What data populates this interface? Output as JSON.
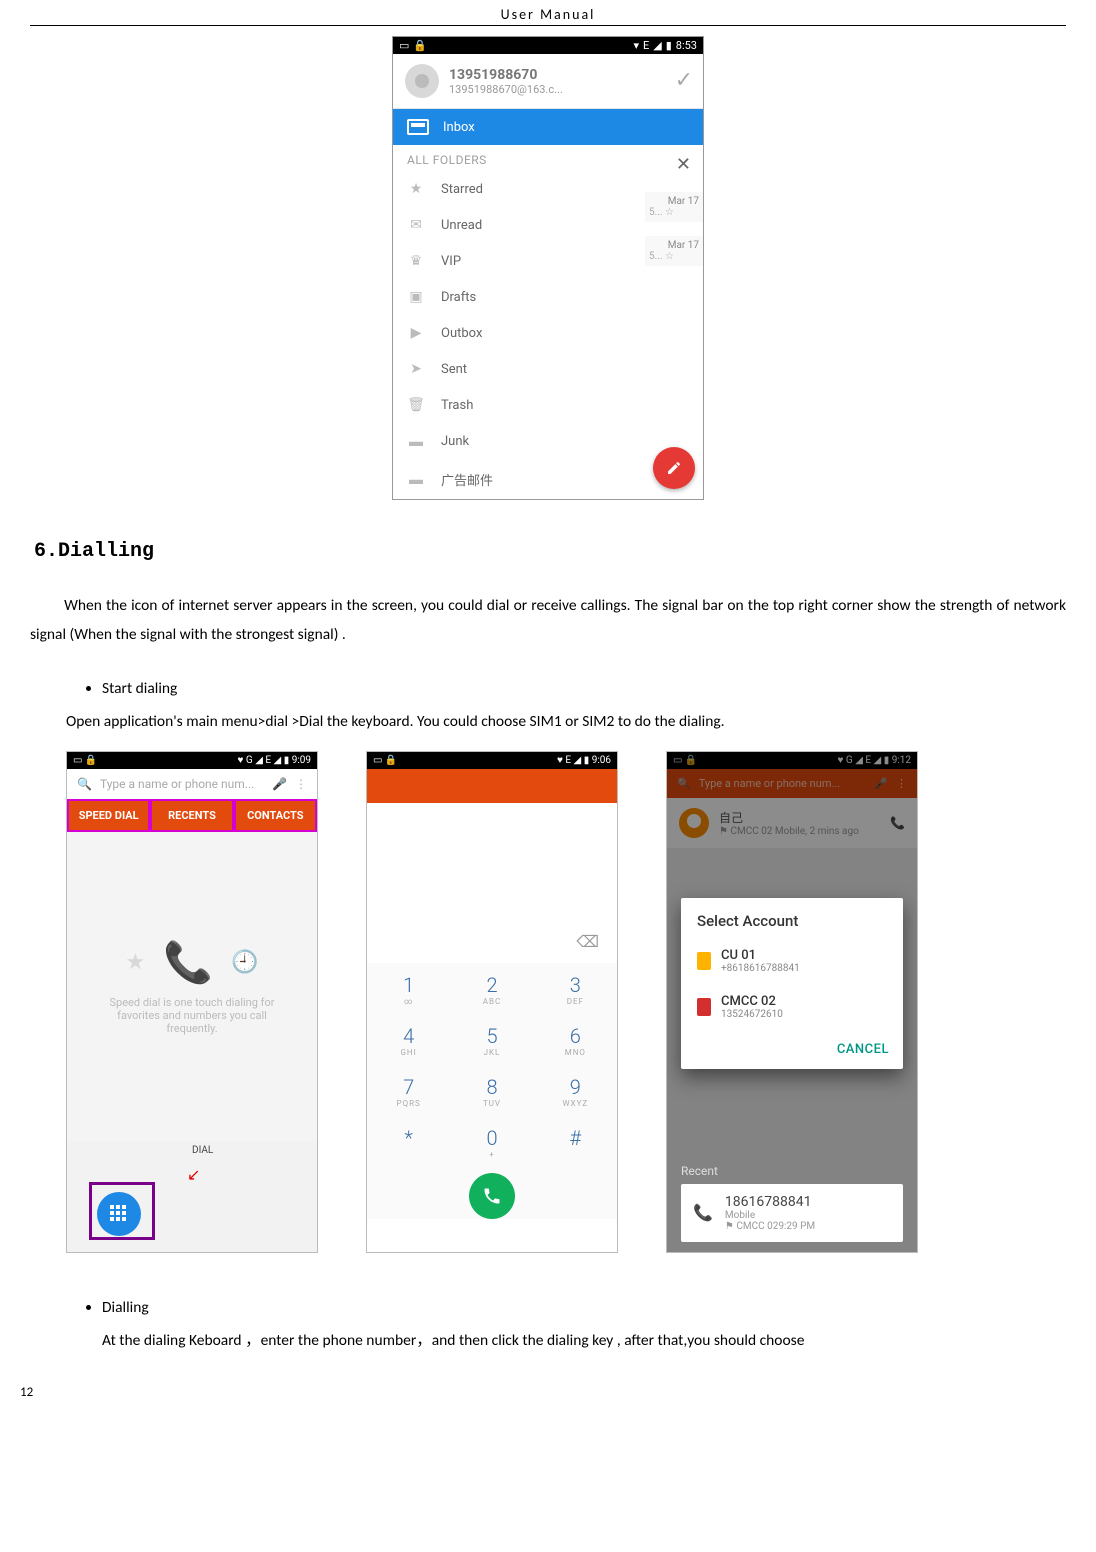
{
  "doc": {
    "header": "User    Manual",
    "page_number": "12"
  },
  "email_shot": {
    "status": {
      "time": "8:53",
      "net": "E",
      "wifi": "▾",
      "batt": "▮"
    },
    "account": {
      "number": "13951988670",
      "email": "13951988670@163.c..."
    },
    "inbox_label": "Inbox",
    "all_folders_label": "ALL FOLDERS",
    "folders": [
      {
        "icon": "★",
        "label": "Starred"
      },
      {
        "icon": "✉",
        "label": "Unread"
      },
      {
        "icon": "♛",
        "label": "VIP"
      },
      {
        "icon": "▣",
        "label": "Drafts"
      },
      {
        "icon": "▶",
        "label": "Outbox"
      },
      {
        "icon": "➤",
        "label": "Sent"
      },
      {
        "icon": "🗑",
        "label": "Trash"
      },
      {
        "icon": "▬",
        "label": "Junk"
      },
      {
        "icon": "▬",
        "label": "广告邮件"
      }
    ],
    "peek": {
      "date1": "Mar 17",
      "snip1": "5... ☆",
      "date2": "Mar 17",
      "snip2": "5... ☆"
    }
  },
  "section": {
    "heading": "6.Dialling",
    "para1": "When the icon of internet server appears in the screen, you could dial or receive callings. The signal bar on the top right corner show the strength of network signal (When the signal with the strongest signal) .",
    "bullet1": "Start dialing",
    "after_bullet1": "Open application's main menu>dial >Dial the keyboard. You could choose SIM1 or SIM2 to do the dialing.",
    "bullet2": "Dialling",
    "after_bullet2": "At the dialing Keboard  ，enter the phone number，and then click the dialing key , after that,you should choose"
  },
  "shot1": {
    "status_time": "9:09",
    "status_net": "G ◢ E ◢",
    "search_placeholder": "Type a name or phone num...",
    "tabs": [
      "SPEED DIAL",
      "RECENTS",
      "CONTACTS"
    ],
    "empty_text": "Speed dial is one touch dialing for favorites and numbers you call frequently.",
    "dial_label": "DIAL"
  },
  "shot2": {
    "status_time": "9:06",
    "status_net": "E ◢",
    "keys": [
      {
        "n": "1",
        "l": "∞"
      },
      {
        "n": "2",
        "l": "ABC"
      },
      {
        "n": "3",
        "l": "DEF"
      },
      {
        "n": "4",
        "l": "GHI"
      },
      {
        "n": "5",
        "l": "JKL"
      },
      {
        "n": "6",
        "l": "MNO"
      },
      {
        "n": "7",
        "l": "PQRS"
      },
      {
        "n": "8",
        "l": "TUV"
      },
      {
        "n": "9",
        "l": "WXYZ"
      },
      {
        "n": "*",
        "l": ""
      },
      {
        "n": "0",
        "l": "+"
      },
      {
        "n": "#",
        "l": ""
      }
    ]
  },
  "shot3": {
    "status_time": "9:12",
    "status_net": "G ◢ E ◢",
    "search_placeholder": "Type a name or phone num...",
    "contact": {
      "name": "自己",
      "line2": "CMCC 02 Mobile, 2 mins ago"
    },
    "dialog_title": "Select Account",
    "sims": [
      {
        "name": "CU 01",
        "number": "+8618616788841"
      },
      {
        "name": "CMCC 02",
        "number": "13524672610"
      }
    ],
    "cancel": "CANCEL",
    "recent_label": "Recent",
    "recent": {
      "number": "18616788841",
      "line1": "Mobile",
      "line2": "CMCC 029:29 PM"
    }
  }
}
